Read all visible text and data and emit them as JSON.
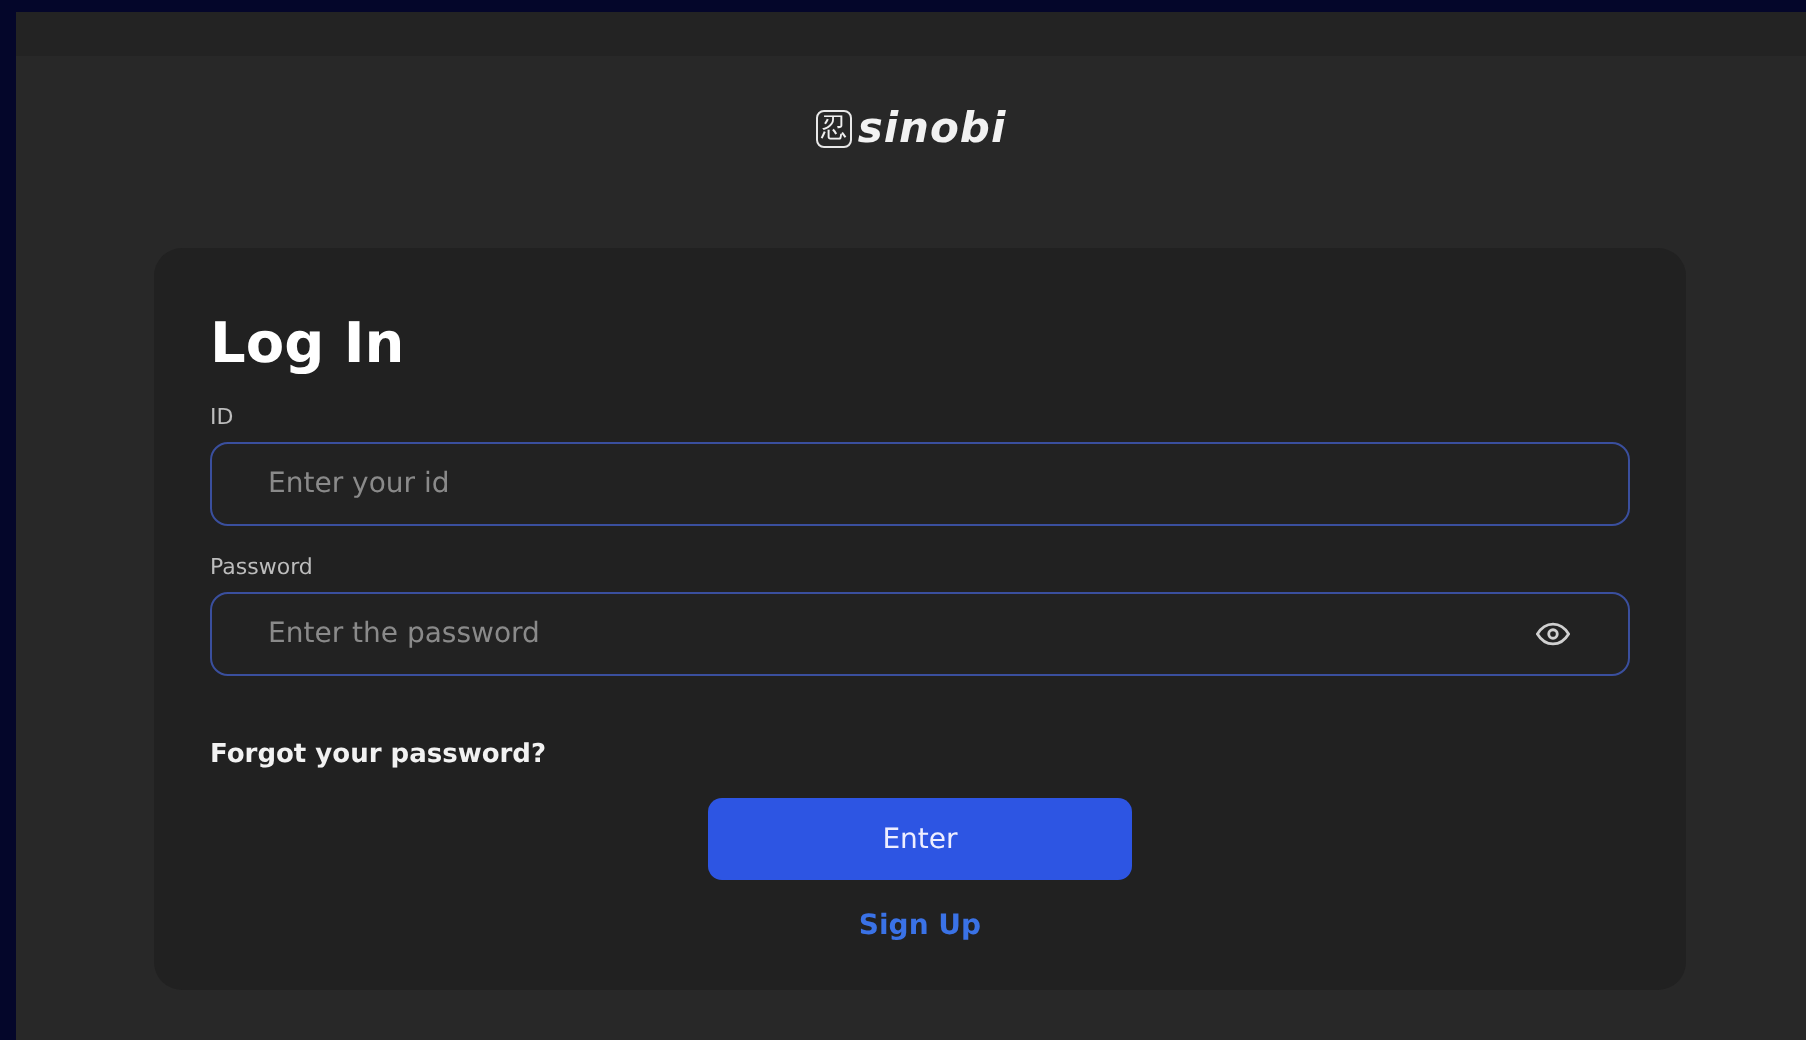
{
  "logo": {
    "mark": "忍",
    "name": "sinobi"
  },
  "title": "Log In",
  "fields": [
    {
      "label": "ID",
      "placeholder": "Enter your id",
      "kind": "text"
    },
    {
      "label": "Password",
      "placeholder": "Enter the password",
      "kind": "password"
    }
  ],
  "forgot_link": "Forgot your password?",
  "submit_button": "Enter",
  "signup_link": "Sign Up"
}
